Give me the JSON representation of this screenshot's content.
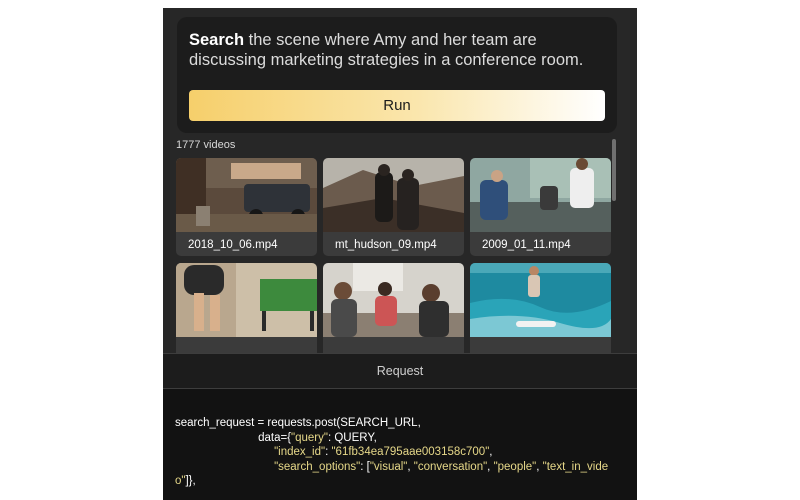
{
  "query": {
    "keyword": "Search",
    "text": " the scene where Amy and her team are discussing marketing strategies in a conference room.",
    "run_label": "Run"
  },
  "results": {
    "count_label": "1777 videos",
    "videos": [
      {
        "filename": "2018_10_06.mp4"
      },
      {
        "filename": "mt_hudson_09.mp4"
      },
      {
        "filename": "2009_01_11.mp4"
      },
      {
        "filename": ""
      },
      {
        "filename": ""
      },
      {
        "filename": ""
      }
    ]
  },
  "request": {
    "header": "Request",
    "code": {
      "l1": "search_request = requests.post(SEARCH_URL,",
      "l2_a": "data={",
      "l2_b": "\"query\"",
      "l2_c": ": QUERY,",
      "l3_a": "\"index_id\"",
      "l3_b": ": ",
      "l3_c": "\"61fb34ea795aae003158c700\"",
      "l3_d": ",",
      "l4_a": "\"search_options\"",
      "l4_b": ": [",
      "l4_c": "\"visual\"",
      "l4_d": ", ",
      "l4_e": "\"conversation\"",
      "l4_f": ", ",
      "l4_g": "\"people\"",
      "l4_h": ", ",
      "l4_i": "\"text_in_vide",
      "l5_a": "o\"",
      "l5_b": "]},"
    }
  },
  "colors": {
    "panel_bg": "#272727",
    "card_bg": "#1c1c1c",
    "run_gradient_start": "#f6cf6b",
    "code_string": "#e6d889",
    "code_bg": "#121212"
  }
}
